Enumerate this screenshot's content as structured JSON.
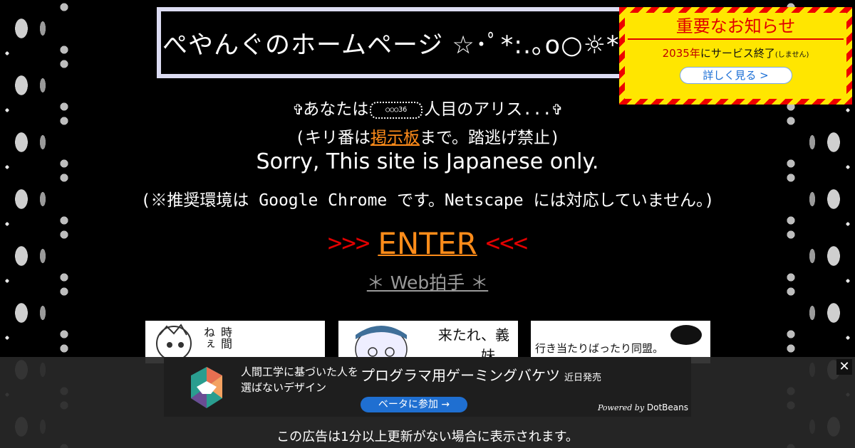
{
  "header": {
    "title": "ぺやんぐのホームページ ☆･ﾟ*:.｡o○☼*ﾟ*"
  },
  "notice": {
    "title": "重要なお知らせ",
    "year_text": "2035年",
    "service_text": "にサービス終了",
    "small_text": "(しません)",
    "button_label": "詳しく見る >"
  },
  "intro": {
    "counter_prefix": "✞あなたは",
    "counter_value": "○○○36",
    "counter_suffix": "人目のアリス...✞",
    "kiri_prefix": "(キリ番は",
    "kiri_link": "掲示板",
    "kiri_suffix": "まで。踏逃げ禁止)",
    "sorry": "Sorry, This site is Japanese only.",
    "environment": "(※推奨環境は Google Chrome です。Netscape には対応していません。)"
  },
  "nav": {
    "arrows_left": ">>>",
    "enter_label": "ENTER",
    "arrows_right": "<<<",
    "clap_label": "＊ Web拍手 ＊"
  },
  "banners": [
    {
      "text": "時間 ねぇ"
    },
    {
      "text": "来たれ、義妹。"
    },
    {
      "text": "行き当たりばったり同盟。"
    }
  ],
  "ad": {
    "close_label": "✕",
    "tagline": "人間工学に基づいた人を選ばないデザイン",
    "headline": "プログラマ用ゲーミングバケツ",
    "soon": "近日発売",
    "cta_label": "ベータに参加 →",
    "powered_prefix": "Powered by",
    "powered_brand": "DotBeans",
    "footer_notice": "この広告は1分以上更新がない場合に表示されます。"
  },
  "colors": {
    "accent_orange": "#ff8c1a",
    "arrow_red": "#e10000",
    "notice_yellow": "#ffe600",
    "ad_blue": "#1f6fd1"
  }
}
